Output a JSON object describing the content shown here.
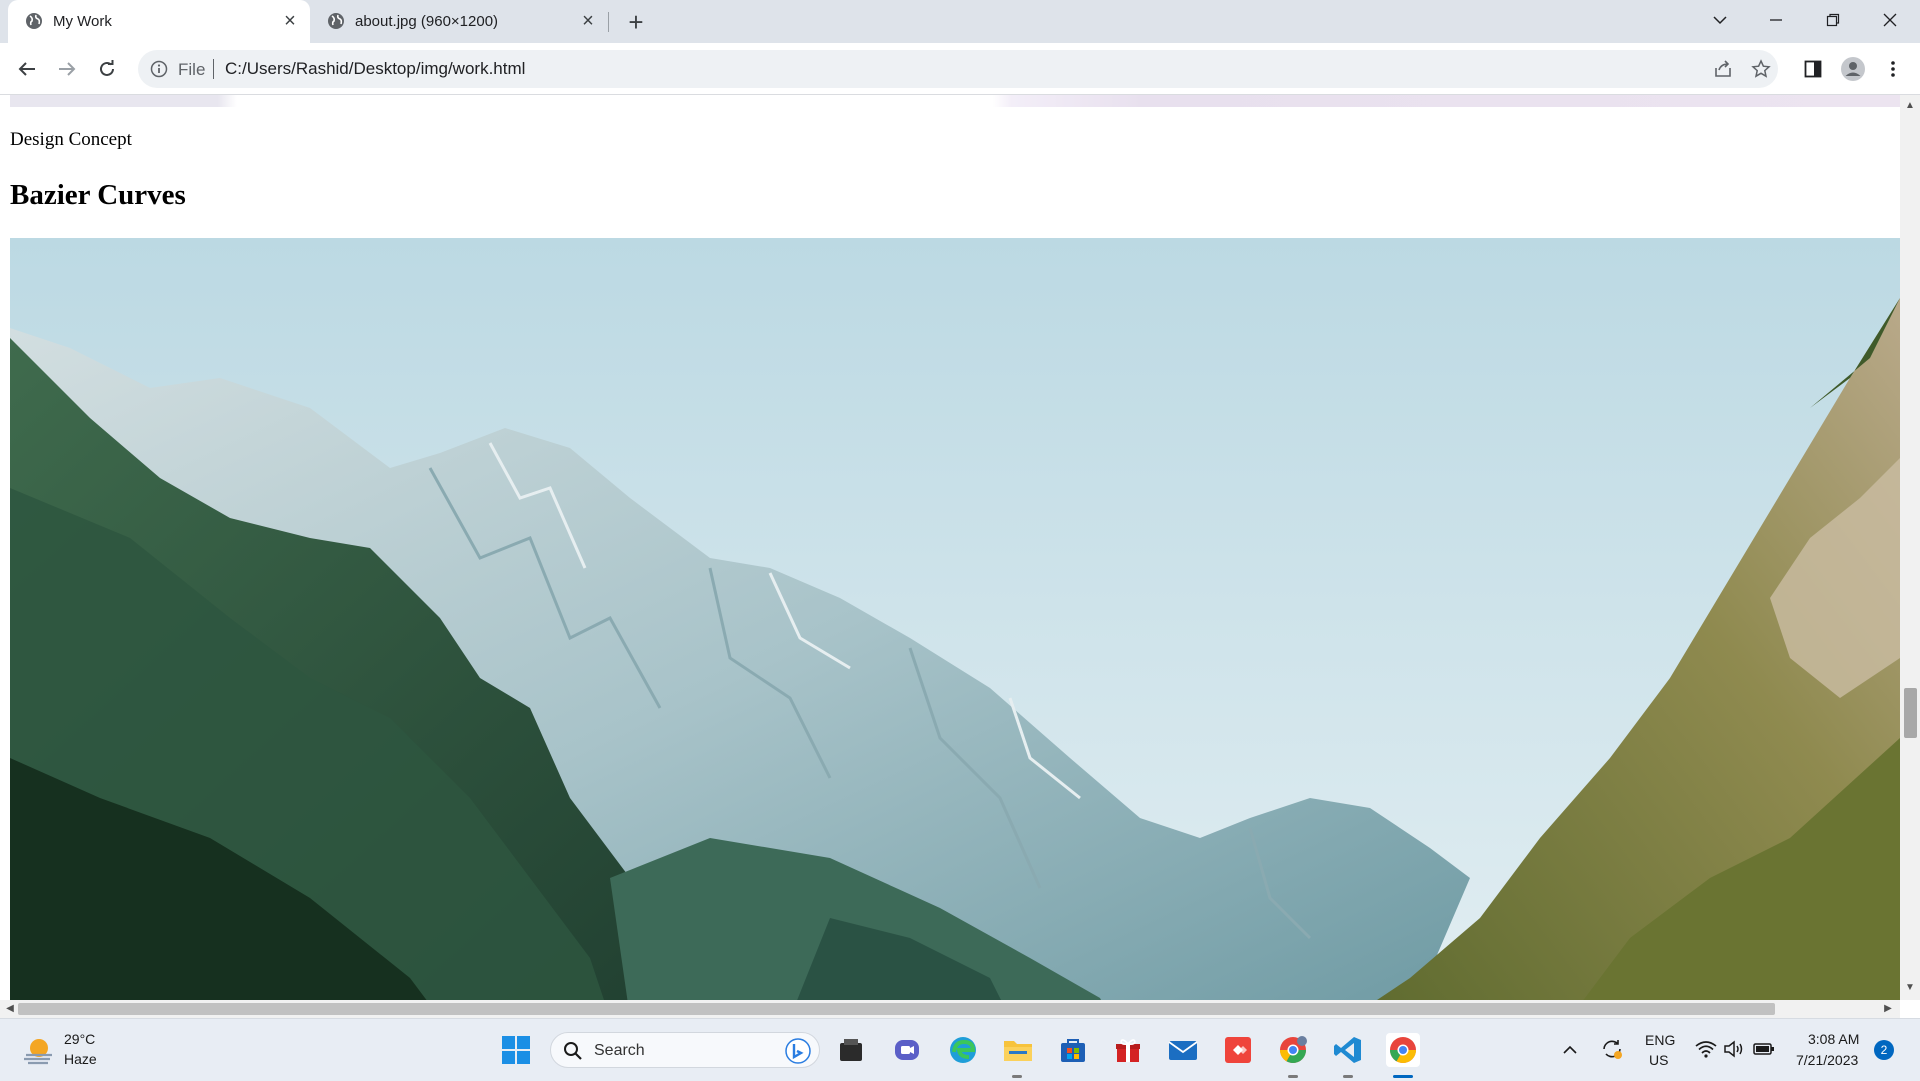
{
  "browser": {
    "tabs": [
      {
        "title": "My Work",
        "active": true,
        "icon": "globe-icon"
      },
      {
        "title": "about.jpg (960×1200)",
        "active": false,
        "icon": "globe-icon"
      }
    ],
    "new_tab_symbol": "+",
    "close_symbol": "×",
    "address": {
      "scheme_label": "File",
      "url": "C:/Users/Rashid/Desktop/img/work.html"
    }
  },
  "page": {
    "caption": "Design Concept",
    "heading": "Bazier Curves",
    "image_subject": "mountain-valley-photo"
  },
  "taskbar": {
    "weather": {
      "temperature": "29°C",
      "condition": "Haze"
    },
    "search_label": "Search",
    "pinned_apps": [
      "file-manager-app",
      "teams-app",
      "edge-app",
      "file-explorer-app",
      "store-app",
      "gift-app",
      "mail-app",
      "anydesk-app",
      "chrome-canary-app",
      "vscode-app",
      "chrome-app"
    ],
    "tray": {
      "language": "ENG",
      "region": "US",
      "time": "3:08 AM",
      "date": "7/21/2023",
      "notification_count": "2"
    }
  },
  "colors": {
    "accent": "#0067c0",
    "tabstrip": "#dee3ea",
    "omnibox": "#eef1f4",
    "taskbar": "#e8edf4"
  }
}
